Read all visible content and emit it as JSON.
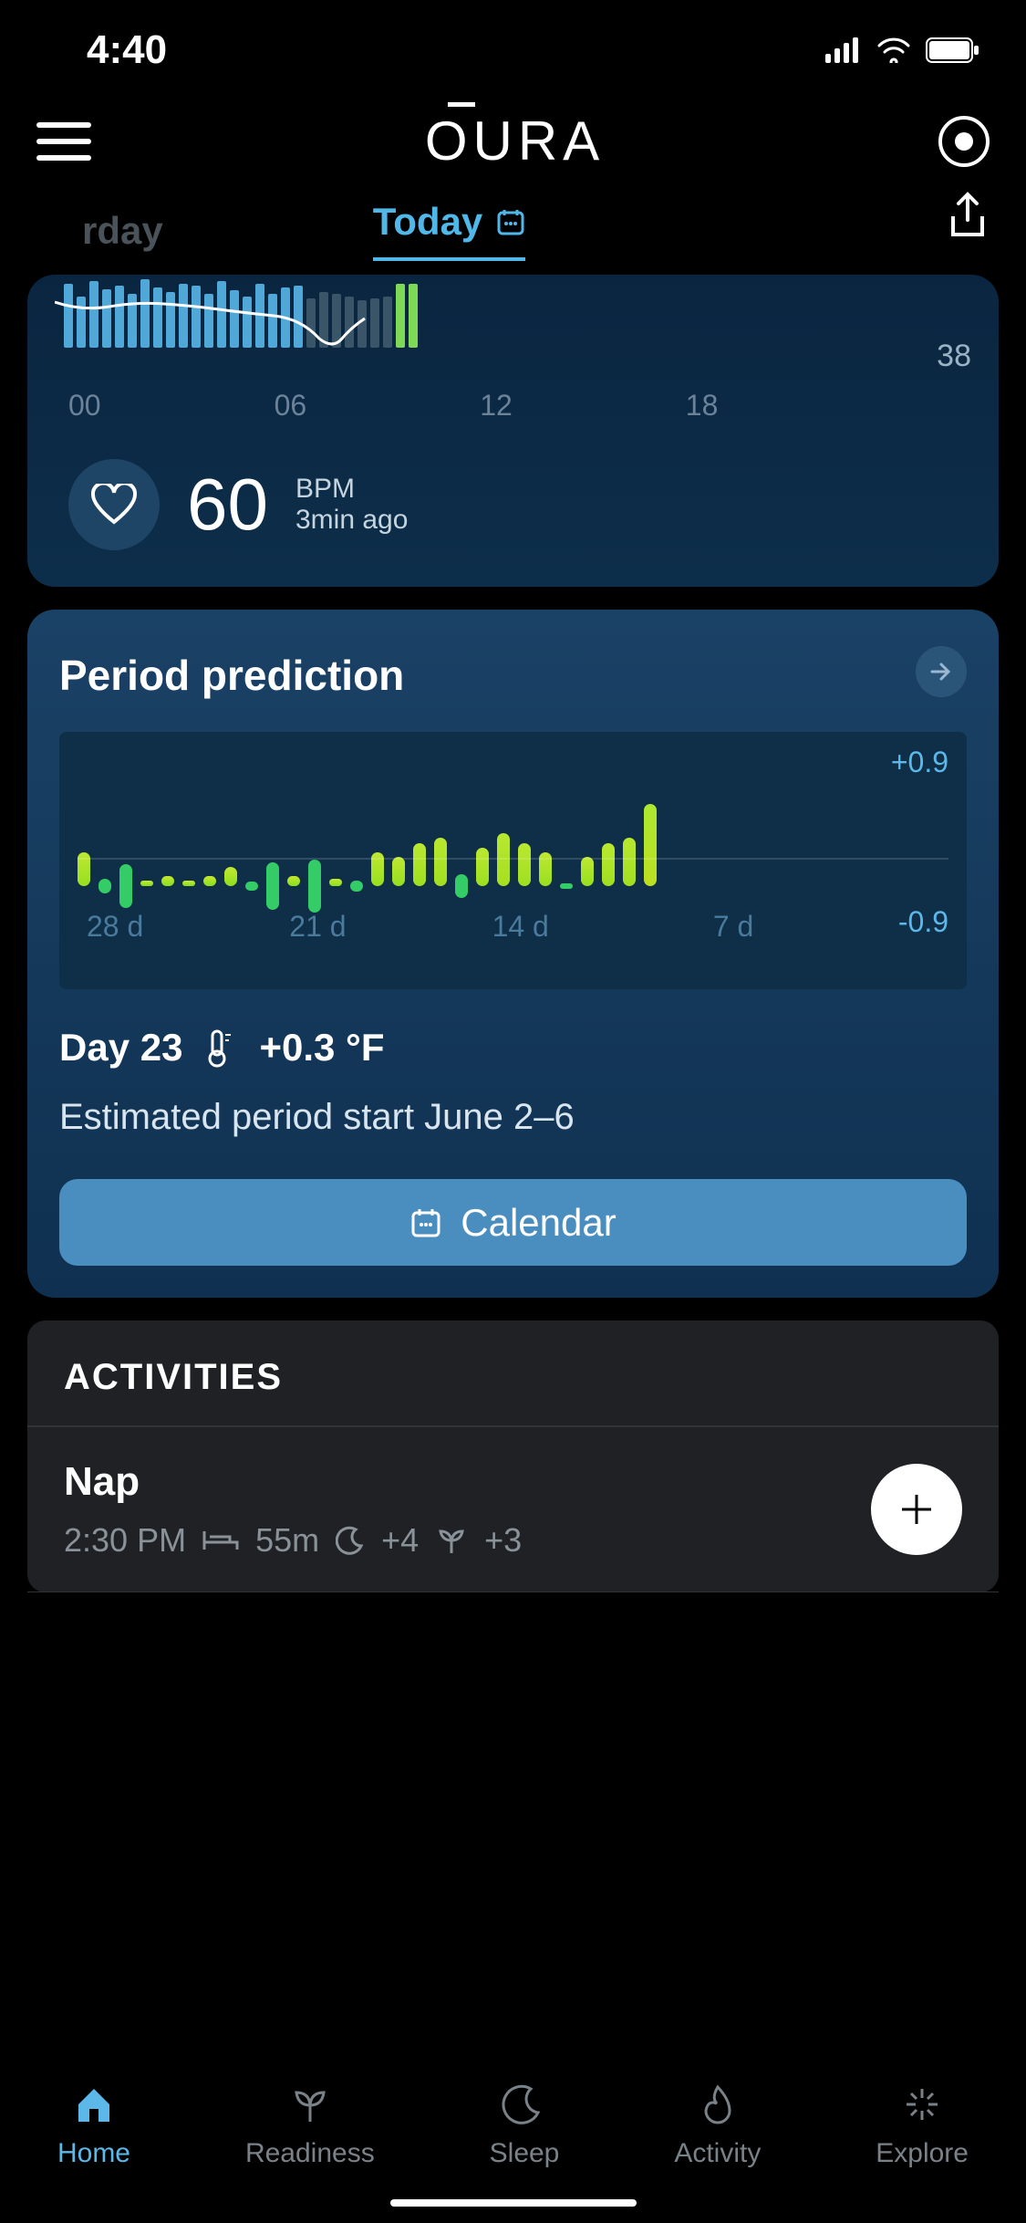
{
  "status": {
    "time": "4:40"
  },
  "header": {
    "logo": "OURA"
  },
  "tabs": {
    "prev": "rday",
    "today": "Today"
  },
  "hr": {
    "side_value": "38",
    "xaxis": [
      "00",
      "06",
      "12",
      "18"
    ],
    "value": "60",
    "unit": "BPM",
    "ago": "3min ago"
  },
  "period": {
    "title": "Period prediction",
    "ytop": "+0.9",
    "ybot": "-0.9",
    "xaxis": [
      "28 d",
      "21 d",
      "14 d",
      "7 d"
    ],
    "day_label": "Day 23",
    "temp": "+0.3 °F",
    "estimate": "Estimated period start June 2–6",
    "calendar_btn": "Calendar"
  },
  "activities": {
    "header": "ACTIVITIES",
    "items": [
      {
        "title": "Nap",
        "time": "2:30 PM",
        "duration": "55m",
        "moon": "+4",
        "sprout": "+3"
      }
    ]
  },
  "nav": {
    "home": "Home",
    "readiness": "Readiness",
    "sleep": "Sleep",
    "activity": "Activity",
    "explore": "Explore"
  },
  "chart_data": [
    {
      "type": "bar",
      "title": "Period prediction — body temperature deviation (°F)",
      "ylabel": "°F",
      "ylim": [
        -0.9,
        0.9
      ],
      "x": [
        28,
        27,
        26,
        25,
        24,
        23,
        22,
        21,
        20,
        19,
        18,
        17,
        16,
        15,
        14,
        13,
        12,
        11,
        10,
        9,
        8,
        7,
        6,
        5,
        4,
        3,
        2,
        1
      ],
      "x_tick_labels": [
        "28 d",
        "21 d",
        "14 d",
        "7 d"
      ],
      "values": [
        0.35,
        -0.15,
        -0.45,
        0.05,
        0.1,
        0.05,
        0.1,
        0.2,
        -0.1,
        -0.5,
        0.1,
        -0.55,
        0.08,
        -0.12,
        0.35,
        0.3,
        0.45,
        0.5,
        -0.25,
        0.4,
        0.55,
        0.45,
        0.35,
        -0.05,
        0.3,
        0.45,
        0.5,
        0.85
      ]
    },
    {
      "type": "bar",
      "title": "Heart rate (partial)",
      "ylabel": "BPM",
      "x_tick_labels": [
        "00",
        "06",
        "12",
        "18"
      ],
      "side_label": 38,
      "values": [
        60,
        48,
        62,
        55,
        58,
        50,
        64,
        56,
        52,
        60,
        58,
        50,
        62,
        54,
        48,
        60,
        50,
        56,
        58,
        46,
        52,
        50,
        48,
        44,
        46,
        48,
        60,
        60
      ]
    }
  ]
}
